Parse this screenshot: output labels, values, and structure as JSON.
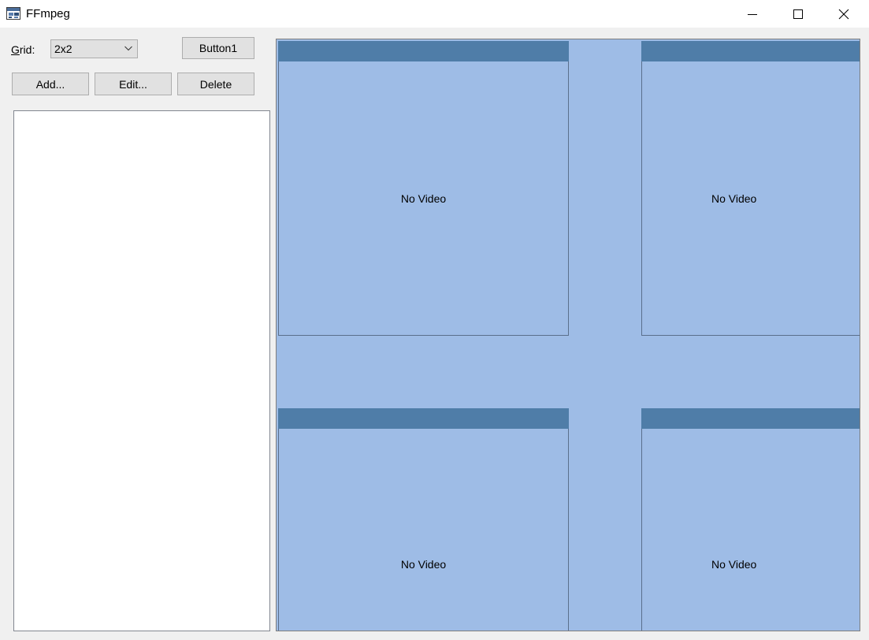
{
  "window": {
    "title": "FFmpeg",
    "app_icon": "app-window-icon",
    "controls": {
      "minimize_icon": "minimize-icon",
      "maximize_icon": "maximize-icon",
      "close_icon": "close-icon"
    }
  },
  "toolbar": {
    "grid_label_mnemonic": "G",
    "grid_label_rest": "rid:",
    "grid_value": "2x2",
    "button1_label": "Button1",
    "add_label": "Add...",
    "edit_label": "Edit...",
    "delete_label": "Delete"
  },
  "video_grid": {
    "tiles": [
      {
        "text": "No Video"
      },
      {
        "text": "No Video"
      },
      {
        "text": "No Video"
      },
      {
        "text": "No Video"
      }
    ]
  },
  "colors": {
    "tile_background": "#9ebce6",
    "tile_header": "#4f7da8",
    "button_face": "#e1e1e1",
    "window_background": "#f0f0f0"
  }
}
